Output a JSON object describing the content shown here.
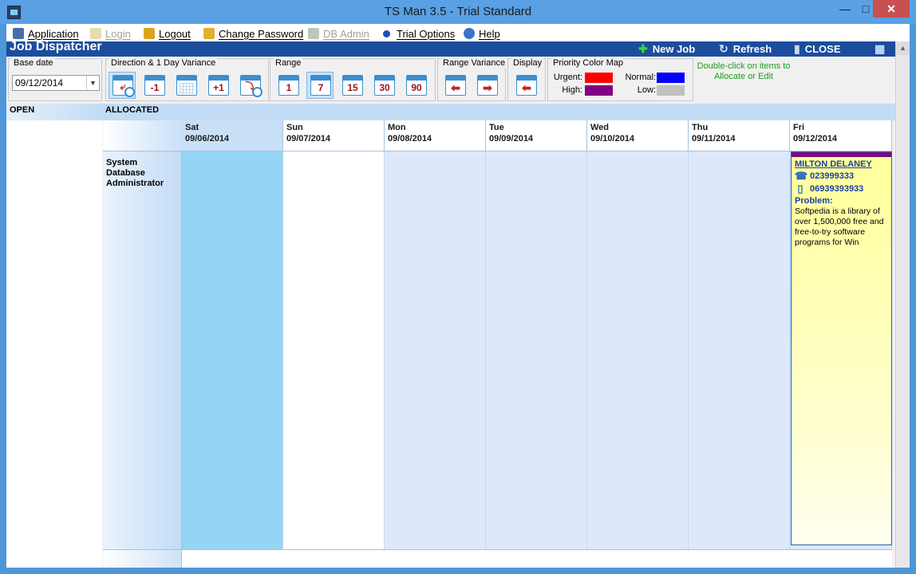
{
  "window": {
    "title": "TS Man 3.5 - Trial Standard"
  },
  "menu": [
    {
      "label": "Application",
      "icon": "application-icon",
      "disabled": false
    },
    {
      "label": "Login",
      "icon": "login-key-icon",
      "disabled": true
    },
    {
      "label": "Logout",
      "icon": "lock-icon",
      "disabled": false
    },
    {
      "label": "Change Password",
      "icon": "key-icon",
      "disabled": false
    },
    {
      "label": "DB Admin",
      "icon": "db-admin-icon",
      "disabled": true
    },
    {
      "label": "Trial Options",
      "icon": "trial-options-icon",
      "disabled": false
    },
    {
      "label": "Help",
      "icon": "help-icon",
      "disabled": false
    }
  ],
  "header": {
    "title": "Job Dispatcher",
    "new_job": "New Job",
    "refresh": "Refresh",
    "close": "CLOSE"
  },
  "toolbar": {
    "base_date_label": "Base date",
    "base_date_value": "09/12/2014",
    "direction_label": "Direction & 1 Day  Variance",
    "range_label": "Range",
    "range_options": [
      "1",
      "7",
      "15",
      "30",
      "90"
    ],
    "range_selected": "7",
    "range_variance_label": "Range Variance",
    "display_label": "Display",
    "priority_label": "Priority Color Map",
    "priorities": [
      {
        "label": "Urgent:",
        "color": "#ff0000"
      },
      {
        "label": "High:",
        "color": "#800080"
      },
      {
        "label": "Normal:",
        "color": "#0000ff"
      },
      {
        "label": "Low:",
        "color": "#c0c0c0"
      }
    ],
    "hint": "Double-click on items to Allocate or Edit"
  },
  "sections": {
    "open": "OPEN",
    "allocated": "ALLOCATED"
  },
  "days": [
    {
      "name": "Sat",
      "date": "09/06/2014"
    },
    {
      "name": "Sun",
      "date": "09/07/2014"
    },
    {
      "name": "Mon",
      "date": "09/08/2014"
    },
    {
      "name": "Tue",
      "date": "09/09/2014"
    },
    {
      "name": "Wed",
      "date": "09/10/2014"
    },
    {
      "name": "Thu",
      "date": "09/11/2014"
    },
    {
      "name": "Fri",
      "date": "09/12/2014"
    }
  ],
  "resource": {
    "name": "System Database Administrator"
  },
  "job": {
    "customer": "MILTON DELANEY",
    "phone": "023999333",
    "mobile": "06939393933",
    "problem_label": "Problem:",
    "problem_text": "Softpedia is a library of over 1,500,000 free and free-to-try software programs for Win",
    "priority_color": "#800080"
  },
  "colors": {
    "header_blue": "#1c4d9c",
    "selected_day": "#96d4f5",
    "weekday": "#dde9fa",
    "hint_green": "#1e9a1e"
  }
}
